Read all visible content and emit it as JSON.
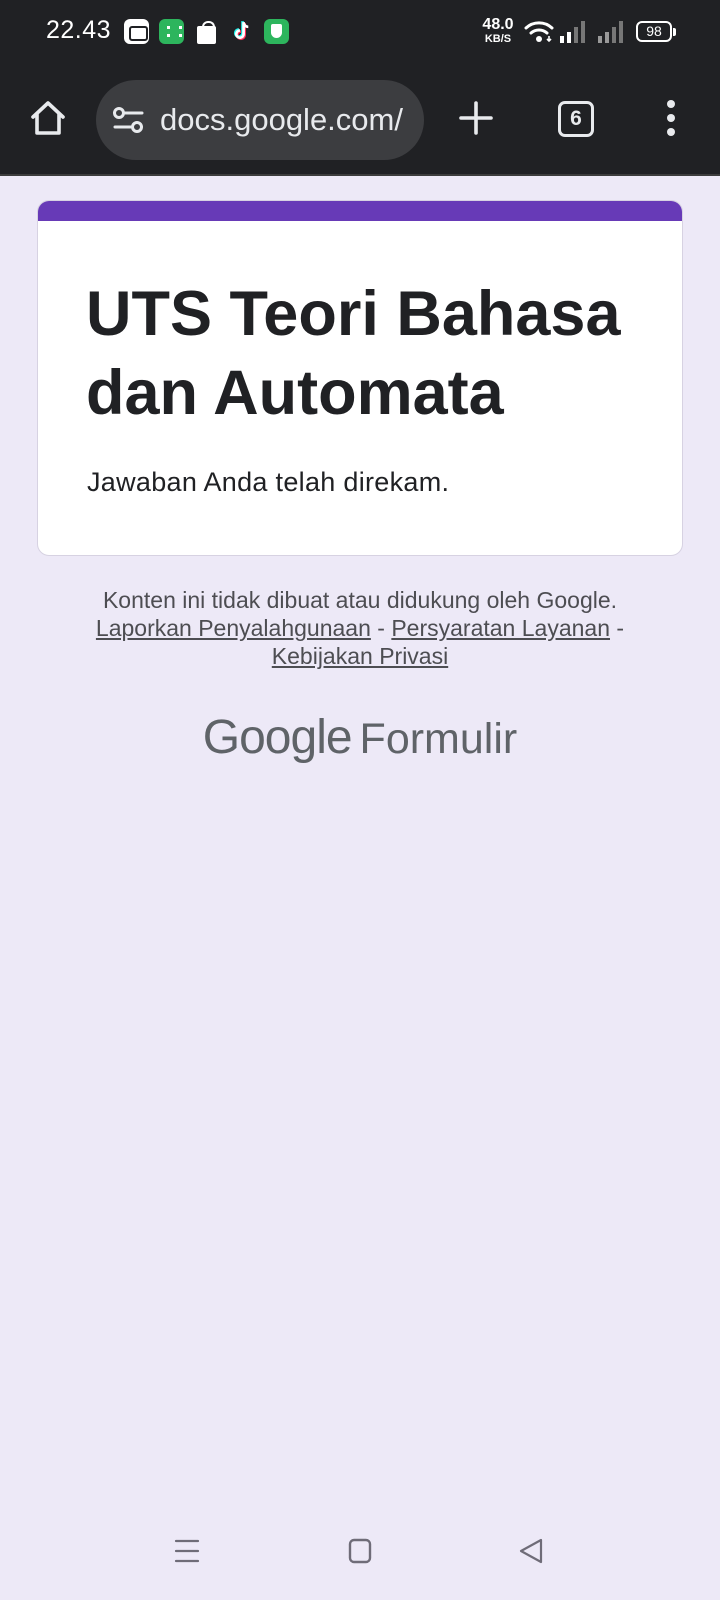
{
  "status_bar": {
    "time": "22.43",
    "net_speed_value": "48.0",
    "net_speed_unit": "KB/S",
    "battery": "98",
    "notification_icons": [
      "video-icon",
      "app-store-icon",
      "shopping-bag-icon",
      "tiktok-icon",
      "shield-icon"
    ]
  },
  "browser": {
    "url": "docs.google.com/",
    "tab_count": "6"
  },
  "form": {
    "title": "UTS Teori Bahasa dan Automata",
    "message": "Jawaban Anda telah direkam.",
    "accent_color": "#673ab7"
  },
  "footer": {
    "disclaimer": "Konten ini tidak dibuat atau didukung oleh Google.",
    "links": [
      "Laporkan Penyalahgunaan",
      "Persyaratan Layanan",
      "Kebijakan Privasi"
    ],
    "separator": "-",
    "brand_google": "Google",
    "brand_product": "Formulir"
  },
  "nav_bar": {
    "buttons": [
      "menu-icon",
      "home-square-icon",
      "back-triangle-icon"
    ]
  }
}
